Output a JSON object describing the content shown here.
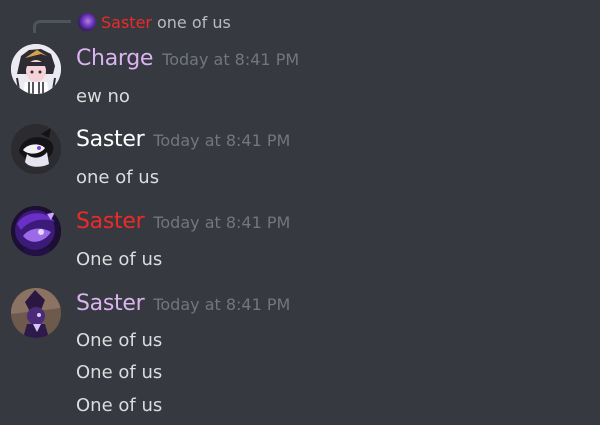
{
  "reply": {
    "author": "Saster",
    "text": "one of us",
    "author_color": "#ed2a2a"
  },
  "messages": [
    {
      "author": "Charge",
      "author_color": "#dab4f0",
      "timestamp": "Today at 8:41 PM",
      "lines": [
        "ew no"
      ],
      "avatar": "avatar-charge"
    },
    {
      "author": "Saster",
      "author_color": "#ffffff",
      "timestamp": "Today at 8:41 PM",
      "lines": [
        "one of us"
      ],
      "avatar": "avatar-saster-white"
    },
    {
      "author": "Saster",
      "author_color": "#ed2a2a",
      "timestamp": "Today at 8:41 PM",
      "lines": [
        "One of us"
      ],
      "avatar": "avatar-saster-purple"
    },
    {
      "author": "Saster",
      "author_color": "#dab4f0",
      "timestamp": "Today at 8:41 PM",
      "lines": [
        "One of us",
        "One of us",
        "One of us"
      ],
      "avatar": "avatar-saster-hat"
    }
  ]
}
